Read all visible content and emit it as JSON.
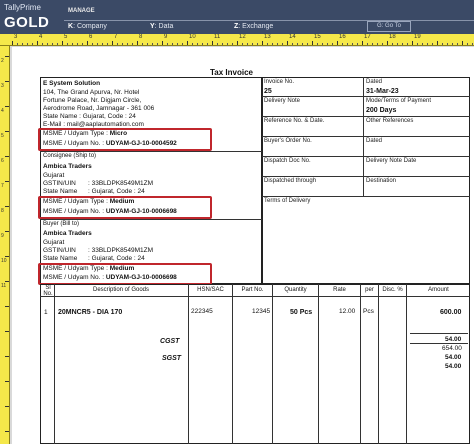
{
  "app": {
    "brand_small": "TallyPrime",
    "brand_large": "GOLD",
    "manage_label": "MANAGE",
    "menu": [
      {
        "key": "K",
        "label": ": Company"
      },
      {
        "key": "Y",
        "label": ": Data"
      },
      {
        "key": "Z",
        "label": ": Exchange"
      }
    ],
    "goto_label": "G: Go To"
  },
  "ruler": {
    "top": [
      "3",
      "4",
      "5",
      "6",
      "7",
      "8",
      "9",
      "10",
      "11",
      "12",
      "13",
      "14",
      "15",
      "16",
      "17",
      "18",
      "19"
    ],
    "left": [
      "2",
      "3",
      "4",
      "5",
      "6",
      "7",
      "8",
      "9",
      "10",
      "11"
    ]
  },
  "invoice": {
    "title": "Tax Invoice",
    "seller": {
      "name": "E System Solution",
      "address": [
        "104, The Grand Apurva, Nr. Hotel",
        "Fortune Palace, Nr. Digjam Circle,",
        "Aerodrome Road, Jamnagar - 361 006"
      ],
      "state": "State Name : Gujarat, Code : 24",
      "email": "E-Mail : mail@aaplautomation.com",
      "msme_type_label": "MSME / Udyam Type : ",
      "msme_type": "Micro",
      "msme_no_label": "MSME / Udyam No. : ",
      "msme_no": "UDYAM-GJ-10-0004592"
    },
    "consignee": {
      "heading": "Consignee (Ship to)",
      "name": "Ambica Traders",
      "state_line": "Gujarat",
      "gstin_label": "GSTIN/UIN",
      "gstin": ": 33BLDPK8549M1ZM",
      "state_label": "State Name",
      "state": ": Gujarat, Code : 24",
      "msme_type_label": "MSME / Udyam Type : ",
      "msme_type": "Medium",
      "msme_no_label": "MSME / Udyam No. : ",
      "msme_no": "UDYAM-GJ-10-0006698"
    },
    "buyer": {
      "heading": "Buyer (Bill to)",
      "name": "Ambica Traders",
      "state_line": "Gujarat",
      "gstin_label": "GSTIN/UIN",
      "gstin": ": 33BLDPK8549M1ZM",
      "state_label": "State Name",
      "state": ": Gujarat, Code : 24",
      "msme_type_label": "MSME / Udyam Type : ",
      "msme_type": "Medium",
      "msme_no_label": "MSME / Udyam No. : ",
      "msme_no": "UDYAM-GJ-10-0006698"
    },
    "meta": {
      "invoice_no_label": "Invoice No.",
      "invoice_no": "25",
      "dated_label": "Dated",
      "dated": "31-Mar-23",
      "delivery_note_label": "Delivery Note",
      "mode_label": "Mode/Terms of Payment",
      "mode": "200 Days",
      "ref_label": "Reference No. & Date.",
      "other_ref_label": "Other References",
      "order_no_label": "Buyer's Order No.",
      "order_dated_label": "Dated",
      "dispatch_doc_label": "Dispatch Doc No.",
      "delivery_note_date_label": "Delivery Note Date",
      "dispatched_label": "Dispatched through",
      "destination_label": "Destination",
      "terms_label": "Terms of Delivery"
    },
    "table": {
      "headers": {
        "sl": "Sl\nNo.",
        "desc": "Description of Goods",
        "hsn": "HSN/SAC",
        "part": "Part No.",
        "qty": "Quantity",
        "rate": "Rate",
        "per": "per",
        "disc": "Disc. %",
        "amount": "Amount"
      },
      "rows": [
        {
          "sl": "1",
          "desc": "20MNCR5 - DIA 170",
          "hsn": "222345",
          "part": "12345",
          "qty": "50 Pcs",
          "rate": "12.00",
          "per": "Pcs",
          "amount": "600.00"
        }
      ],
      "subtotal": "654.00",
      "taxes": [
        {
          "label": "CGST",
          "amount": "54.00"
        },
        {
          "label": "SGST",
          "amount": "54.00"
        }
      ],
      "cgst_line": "54.00",
      "sgst_total": "54.00"
    }
  }
}
